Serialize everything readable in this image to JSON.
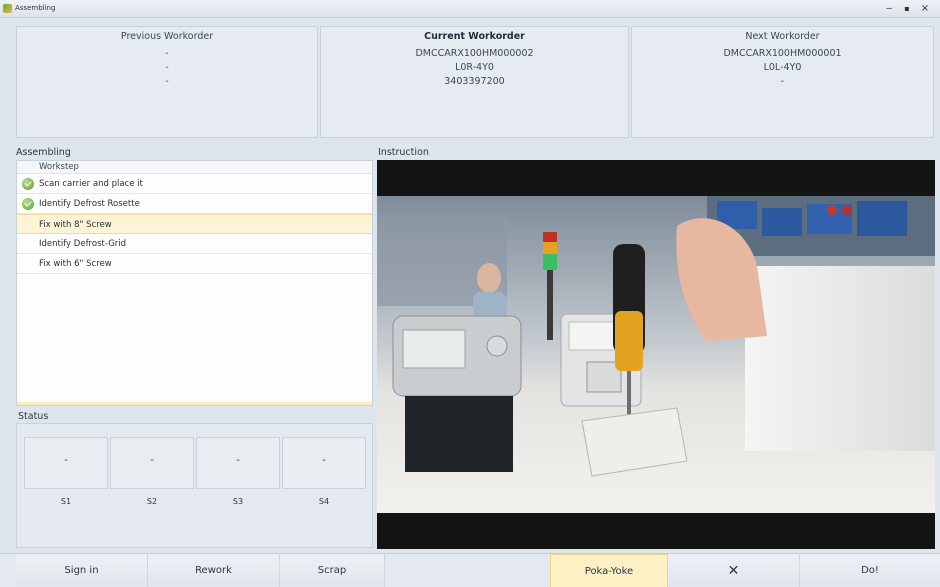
{
  "window": {
    "title": "Assembling",
    "controls": {
      "minimize": "‒",
      "maximize": "▪",
      "close": "×"
    }
  },
  "workorders": {
    "previous": {
      "title": "Previous Workorder",
      "lines": [
        "-",
        "-",
        "-"
      ]
    },
    "current": {
      "title": "Current Workorder",
      "lines": [
        "DMCCARX100HM000002",
        "L0R-4Y0",
        "3403397200"
      ]
    },
    "next": {
      "title": "Next Workorder",
      "lines": [
        "DMCCARX100HM000001",
        "L0L-4Y0",
        "-"
      ]
    }
  },
  "assembling": {
    "label": "Assembling",
    "column_header": "Workstep",
    "steps": [
      {
        "label": "Scan carrier and place it",
        "done": true
      },
      {
        "label": "Identify Defrost Rosette",
        "done": true
      },
      {
        "label": "Fix with 8\" Screw",
        "done": false,
        "active": true
      },
      {
        "label": "Identify Defrost-Grid",
        "done": false
      },
      {
        "label": "Fix with 6\" Screw",
        "done": false
      }
    ]
  },
  "status": {
    "label": "Status",
    "stations": [
      {
        "value": "-",
        "label": "S1"
      },
      {
        "value": "-",
        "label": "S2"
      },
      {
        "value": "-",
        "label": "S3"
      },
      {
        "value": "-",
        "label": "S4"
      }
    ]
  },
  "instruction": {
    "label": "Instruction"
  },
  "bottom": {
    "sign_in": "Sign in",
    "rework": "Rework",
    "scrap": "Scrap",
    "poka_yoke": "Poka-Yoke",
    "tools_icon": "tools-icon",
    "do": "Do!"
  },
  "colors": {
    "accent_highlight": "#fdf0c4",
    "check_green": "#5c9e36",
    "panel_bg": "#e6ebf1"
  }
}
